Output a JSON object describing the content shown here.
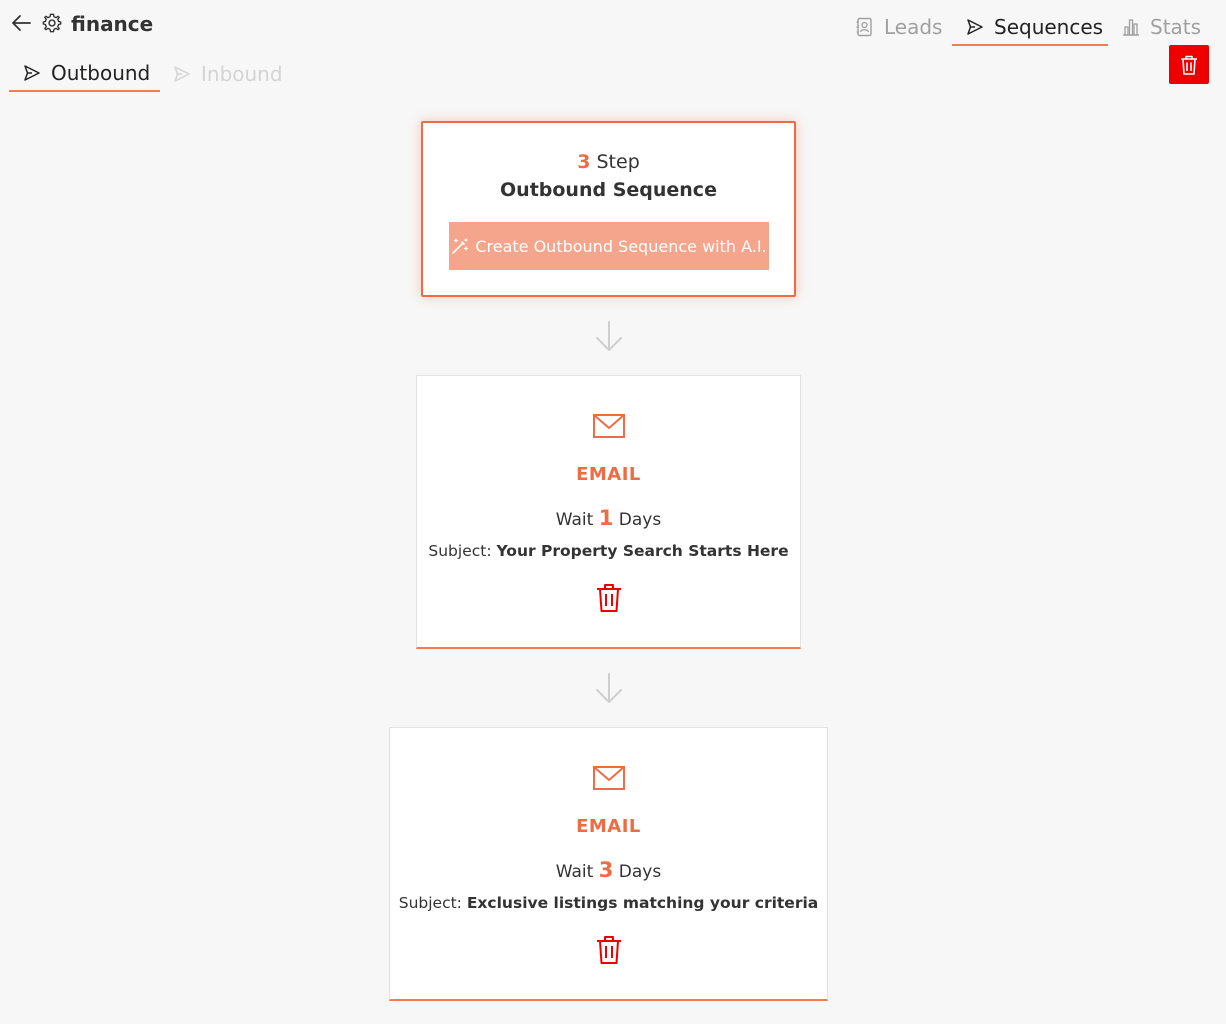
{
  "header": {
    "title": "finance"
  },
  "topnav": [
    {
      "label": "Leads",
      "icon": "contact-book-icon"
    },
    {
      "label": "Sequences",
      "icon": "send-icon"
    },
    {
      "label": "Stats",
      "icon": "bar-chart-icon"
    }
  ],
  "subtabs": [
    {
      "label": "Outbound",
      "icon": "send-icon"
    },
    {
      "label": "Inbound",
      "icon": "send-icon"
    }
  ],
  "summary": {
    "step_count": "3",
    "step_word": "Step",
    "title": "Outbound Sequence",
    "ai_button_label": "Create Outbound Sequence with A.I."
  },
  "steps": [
    {
      "type": "EMAIL",
      "wait_prefix": "Wait",
      "wait_days": "1",
      "wait_suffix": "Days",
      "subject_label": "Subject:",
      "subject": "Your Property Search Starts Here"
    },
    {
      "type": "EMAIL",
      "wait_prefix": "Wait",
      "wait_days": "3",
      "wait_suffix": "Days",
      "subject_label": "Subject:",
      "subject": "Exclusive listings matching your criteria"
    }
  ],
  "colors": {
    "accent": "#ef6c43",
    "accent_light": "#f5a58b",
    "danger": "#ee0000",
    "background": "#f7f7f7"
  }
}
